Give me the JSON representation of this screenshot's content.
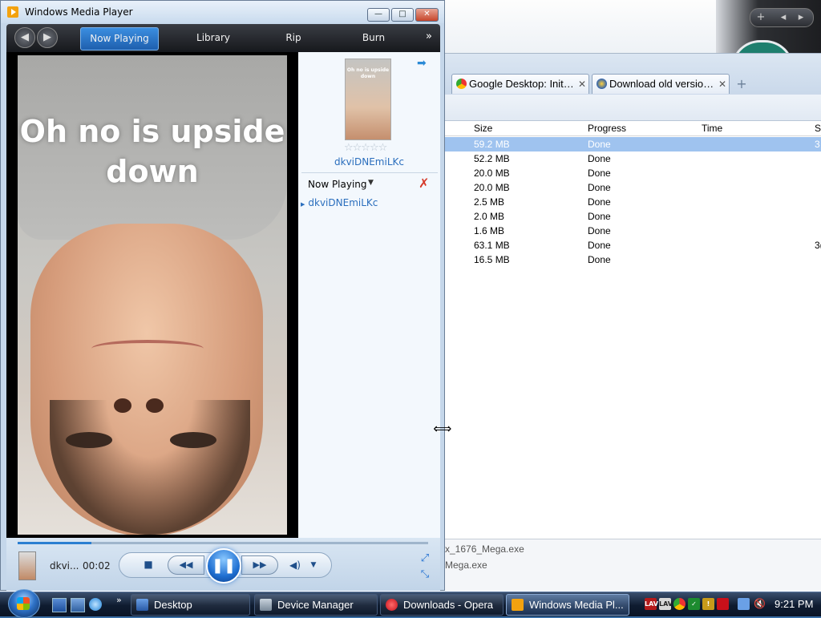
{
  "opera": {
    "tabs": [
      {
        "label": "Google Desktop: Initial ..."
      },
      {
        "label": "Download old versions ..."
      }
    ],
    "downloads": {
      "columns": [
        "Size",
        "Progress",
        "Time",
        "S"
      ],
      "rows": [
        {
          "size": "59.2 MB",
          "progress": "Done",
          "time": "",
          "extra": "3",
          "selected": true
        },
        {
          "size": "52.2 MB",
          "progress": "Done",
          "time": "",
          "extra": ""
        },
        {
          "size": "20.0 MB",
          "progress": "Done",
          "time": "",
          "extra": ""
        },
        {
          "size": "20.0 MB",
          "progress": "Done",
          "time": "",
          "extra": ""
        },
        {
          "size": "2.5 MB",
          "progress": "Done",
          "time": "",
          "extra": ""
        },
        {
          "size": "2.0 MB",
          "progress": "Done",
          "time": "",
          "extra": ""
        },
        {
          "size": "1.6 MB",
          "progress": "Done",
          "time": "",
          "extra": ""
        },
        {
          "size": "63.1 MB",
          "progress": "Done",
          "time": "",
          "extra": "3("
        },
        {
          "size": "16.5 MB",
          "progress": "Done",
          "time": "",
          "extra": ""
        }
      ],
      "bottom_files": [
        "x_1676_Mega.exe",
        "Mega.exe"
      ]
    }
  },
  "wmp": {
    "title": "Windows Media Player",
    "window_buttons": {
      "minimize": "—",
      "maximize": "□",
      "close": "✕"
    },
    "nav_tabs": [
      "Now Playing",
      "Library",
      "Rip",
      "Burn"
    ],
    "nav_more": "»",
    "video_caption": "Oh no is upside down",
    "side_panel": {
      "thumb_caption": "Oh no is upside down",
      "rating": "☆☆☆☆☆",
      "title": "dkviDNEmiLKc",
      "now_playing_label": "Now Playing",
      "playlist": [
        "dkviDNEmiLKc"
      ]
    },
    "controls": {
      "mini_title": "dkvi...",
      "time": "00:02",
      "progress": 0.18
    }
  },
  "taskbar": {
    "tasks": [
      "Desktop",
      "Device Manager",
      "Downloads - Opera",
      "Windows Media Pl..."
    ],
    "clock": "9:21 PM"
  }
}
